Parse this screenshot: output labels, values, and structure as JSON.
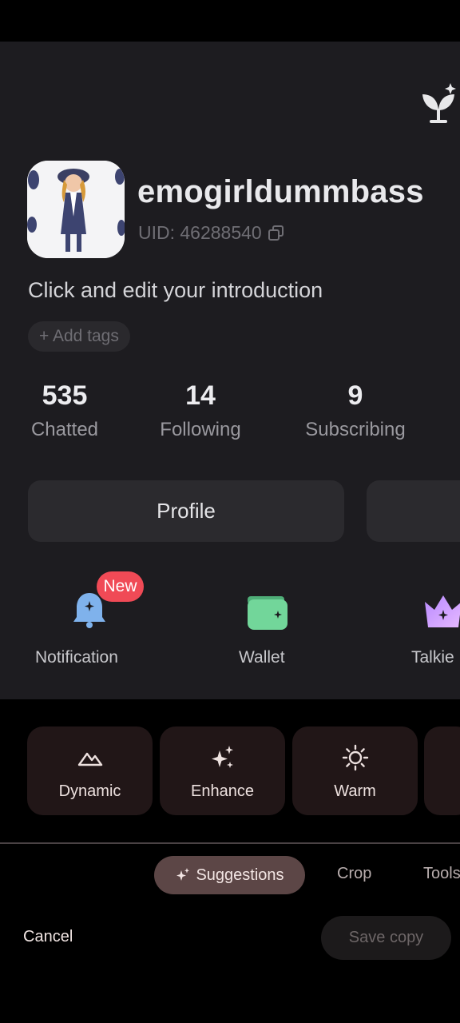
{
  "profile": {
    "username": "emogirldummbass",
    "uid": "UID: 46288540",
    "introduction": "Click and edit your introduction",
    "add_tags": "+ Add tags"
  },
  "stats": [
    {
      "value": "535",
      "label": "Chatted"
    },
    {
      "value": "14",
      "label": "Following"
    },
    {
      "value": "9",
      "label": "Subscribing"
    }
  ],
  "actions": {
    "profile_label": "Profile"
  },
  "features": {
    "notification_label": "Notification",
    "new_badge": "New",
    "wallet_label": "Wallet",
    "talkie_label": "Talkie"
  },
  "editor": {
    "suggestions": [
      {
        "label": "Dynamic",
        "icon": "mountain-icon"
      },
      {
        "label": "Enhance",
        "icon": "sparkle-icon"
      },
      {
        "label": "Warm",
        "icon": "sun-icon"
      }
    ],
    "tabs": {
      "suggestions": "Suggestions",
      "crop": "Crop",
      "tools": "Tools"
    },
    "cancel": "Cancel",
    "save_copy": "Save copy"
  },
  "colors": {
    "preview_bg": "#1d1c20",
    "badge": "#f04a56",
    "card_bg": "#211617",
    "active_tab": "#5c4646"
  }
}
